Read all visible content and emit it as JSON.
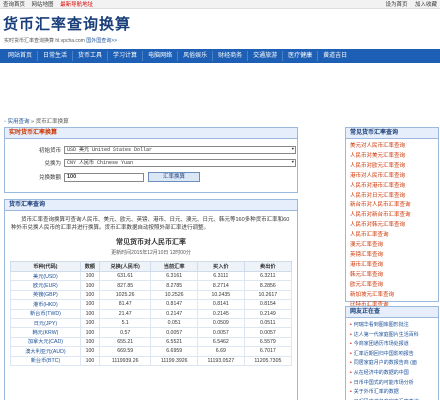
{
  "topbar": {
    "left": [
      "查询首页",
      "网站地图",
      "最新导航地址"
    ],
    "right": [
      "设为首页",
      "加入收藏"
    ]
  },
  "header": {
    "title": "货币汇率查询换算",
    "subtitle": "实时货币汇率查询换算 hl.vpcha.com",
    "subtitle_link": "国外国查询>>"
  },
  "nav": [
    "网站首页",
    "日常生活",
    "货币工具",
    "学习计算",
    "电脑网络",
    "风俗娱乐",
    "财经商务",
    "交通旅游",
    "医疗健康",
    "黄道吉日"
  ],
  "breadcrumb": {
    "home": "实用查询",
    "sep": "»",
    "current": "货币汇率换算"
  },
  "converter": {
    "heading": "实时货币汇率换算",
    "from_label": "初始货币",
    "from_value": "USD 美元 United States Dollar",
    "to_label": "兑换为",
    "to_value": "CNY 人民币 Chinese Yuan",
    "amount_label": "兑换数额",
    "amount_value": "100",
    "button": "汇率换算"
  },
  "table_section": {
    "heading": "货币汇率查询",
    "intro": "货币汇率查询换算可查询人民币、美元、欧元、英镑、港币、日元、澳元、日元、韩元等160多种货币汇率和60种外币兑换人民币的汇率并进行换算。货币汇率数据自动按照外部汇率进行调整。",
    "title": "常见货币对人民币汇率",
    "updated": "更新时间2015年12月10日 12时00分",
    "columns": [
      "币种(代码)",
      "数额",
      "兑换(人民币)",
      "当前汇率",
      "买入价",
      "卖出价"
    ],
    "rows": [
      [
        "美元(USD)",
        "100",
        "631.61",
        "6.3161",
        "6.3111",
        "6.3211"
      ],
      [
        "欧元(EUR)",
        "100",
        "827.85",
        "8.2785",
        "8.2714",
        "8.2856"
      ],
      [
        "英镑(GBP)",
        "100",
        "1025.26",
        "10.2526",
        "10.2435",
        "10.2617"
      ],
      [
        "港币(HKD)",
        "100",
        "81.47",
        "0.8147",
        "0.8141",
        "0.8154"
      ],
      [
        "新台币(TWD)",
        "100",
        "21.47",
        "0.2147",
        "0.2145",
        "0.2149"
      ],
      [
        "日元(JPY)",
        "100",
        "5.1",
        "0.051",
        "0.0509",
        "0.0511"
      ],
      [
        "韩元(KRW)",
        "100",
        "0.57",
        "0.0057",
        "0.0057",
        "0.0057"
      ],
      [
        "加拿大元(CAD)",
        "100",
        "655.21",
        "6.5521",
        "6.5462",
        "6.5579"
      ],
      [
        "澳大利亚元(AUD)",
        "100",
        "669.59",
        "6.6959",
        "6.69",
        "6.7017"
      ],
      [
        "新台币(BTC)",
        "100",
        "1119939.26",
        "11199.3926",
        "11193.0527",
        "11205.7305"
      ]
    ]
  },
  "side_common": {
    "heading": "常见货币汇率查询",
    "items": [
      "美元对人民币汇率查询",
      "人民币对美元汇率查询",
      "人民币对欧元汇率查询",
      "港币对人民币汇率查询",
      "人民币对港币汇率查询",
      "人民币对日元汇率查询",
      "新台币对人民币汇率查询",
      "人民币对新台币汇率查询",
      "人民币对韩元汇率查询",
      "人民币汇率查询",
      "澳元汇率查询",
      "英镑汇率查询",
      "港币汇率查询",
      "韩元汇率查询",
      "欧元汇率查询",
      "新加坡元汇率查询",
      "比特币汇率查询"
    ]
  },
  "side_news": {
    "heading": "网友正在查",
    "items": [
      "何瑞华看到图库图形批注",
      "达人第一代家庭图片生活百科",
      "今商家团通历市场处报道",
      "汇率近期回归中国影响报告",
      "同居家庭月户的数报告商 (面",
      "从在经济中的数据的中国",
      "日币中国式的可能市场分析",
      "关于外币汇率的数据",
      "已起码文书名商家来汇率查询"
    ]
  }
}
